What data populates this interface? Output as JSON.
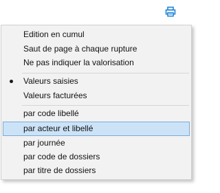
{
  "toolbar": {
    "print_icon": "printer-icon",
    "print_color": "#1e86d6"
  },
  "menu": {
    "items": [
      {
        "label": "Edition en cumul"
      },
      {
        "label": "Saut de page à chaque rupture"
      },
      {
        "label": "Ne pas indiquer la valorisation"
      },
      {
        "label": "Valeurs saisies",
        "checked": true
      },
      {
        "label": "Valeurs facturées"
      },
      {
        "label": "par code libellé"
      },
      {
        "label": "par acteur et libellé",
        "highlighted": true
      },
      {
        "label": "par journée"
      },
      {
        "label": "par code de dossiers"
      },
      {
        "label": "par titre de dossiers"
      }
    ]
  },
  "colors": {
    "highlight_bg": "#cce3f7",
    "highlight_border": "#7aabd9",
    "menu_bg": "#f2f2f2"
  }
}
